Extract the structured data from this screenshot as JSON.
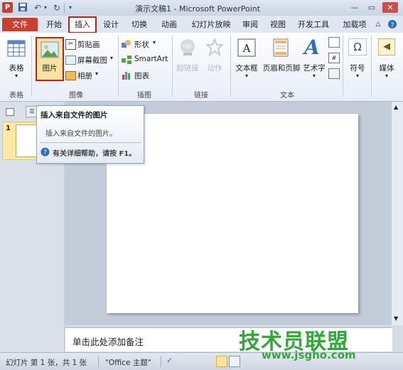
{
  "title_bar": {
    "app_letter": "P",
    "title": "演示文稿1 - Microsoft PowerPoint",
    "qat_icons": [
      "save-icon",
      "undo-icon",
      "redo-icon"
    ]
  },
  "tabs": {
    "file": "文件",
    "items": [
      "开始",
      "插入",
      "设计",
      "切换",
      "动画",
      "幻灯片放映",
      "审阅",
      "视图",
      "开发工具",
      "加载项"
    ]
  },
  "ribbon": {
    "table_group": {
      "button": "表格",
      "label": "表格"
    },
    "images_group": {
      "picture": "图片",
      "clipart": "剪贴画",
      "screenshot": "屏幕截图",
      "album": "相册",
      "label": "图像"
    },
    "illustrations_group": {
      "shapes": "形状",
      "smartart": "SmartArt",
      "chart": "图表",
      "label": "插图"
    },
    "links_group": {
      "hyperlink": "超链接",
      "action": "动作",
      "label": "链接"
    },
    "text_group": {
      "textbox": "文本框",
      "header_footer": "页眉和页脚",
      "wordart": "艺术字",
      "label": "文本"
    },
    "symbols": {
      "symbol": "符号"
    },
    "media": {
      "media": "媒体"
    }
  },
  "slide_panel": {
    "slide_number": "1"
  },
  "tooltip": {
    "title": "插入来自文件的图片",
    "description": "插入来自文件的图片。",
    "help": "有关详细帮助，请按 F1。"
  },
  "notes": {
    "placeholder": "单击此处添加备注"
  },
  "status_bar": {
    "slide_info": "幻灯片 第 1 张，共 1 张",
    "theme": "\"Office 主题\""
  },
  "watermark": {
    "brand": "技术员联盟",
    "url": "www.jsgho.com"
  }
}
